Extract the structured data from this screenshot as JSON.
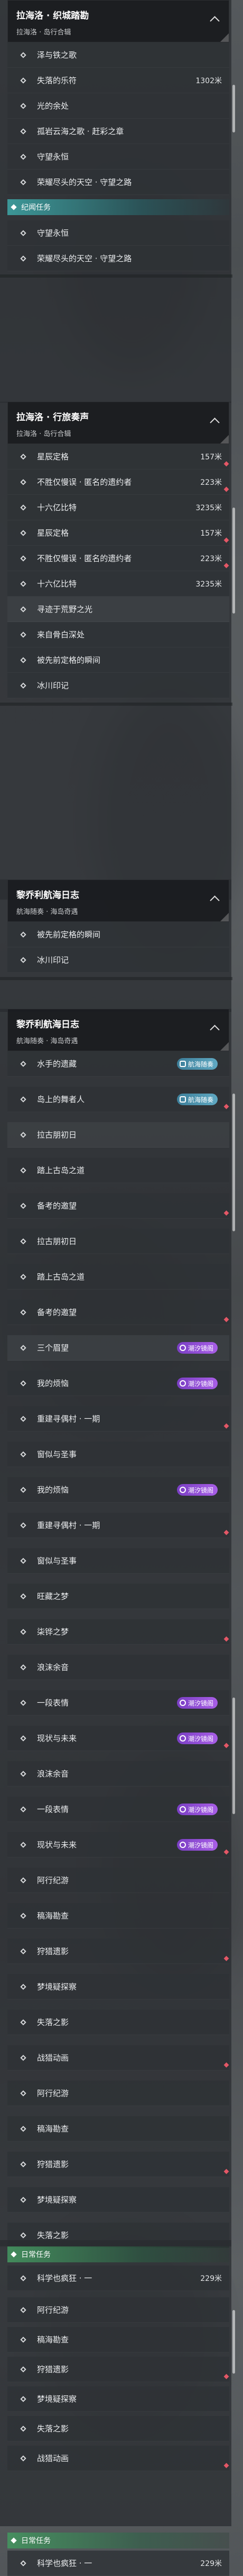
{
  "panel1": {
    "title": "拉海洛 · 织城踏勘",
    "subtitle": "拉海洛 · 岛行合辑",
    "items": [
      {
        "label": "泽与铁之歌",
        "dist": ""
      },
      {
        "label": "失落的乐符",
        "dist": "1302米"
      },
      {
        "label": "光的余处",
        "dist": ""
      },
      {
        "label": "孤岩云海之歌 · 赶彩之章",
        "dist": ""
      },
      {
        "label": "守望永恒",
        "dist": ""
      },
      {
        "label": "荣耀尽头的天空 · 守望之路",
        "dist": ""
      }
    ],
    "section": "纪闻任务",
    "items2": [
      {
        "label": "守望永恒",
        "dist": ""
      },
      {
        "label": "荣耀尽头的天空 · 守望之路",
        "dist": ""
      }
    ]
  },
  "panel2": {
    "title": "拉海洛 · 行旅奏声",
    "subtitle": "拉海洛 · 岛行合辑",
    "items": [
      {
        "label": "星辰定格",
        "dist": "157米"
      },
      {
        "label": "不胜仅慢误 · 匿名的遗约者",
        "dist": "223米"
      },
      {
        "label": "十六亿比特",
        "dist": "3235米"
      },
      {
        "label": "星辰定格",
        "dist": "157米"
      },
      {
        "label": "不胜仅慢误 · 匿名的遗约者",
        "dist": "223米"
      },
      {
        "label": "十六亿比特",
        "dist": "3235米"
      },
      {
        "label": "寻迹于荒野之光",
        "dist": ""
      },
      {
        "label": "来自骨白深处",
        "dist": ""
      },
      {
        "label": "被先前定格的瞬间",
        "dist": ""
      },
      {
        "label": "冰川印记",
        "dist": ""
      }
    ]
  },
  "panel3": {
    "title": "黎乔利航海日志",
    "subtitle": "航海随奏 · 海岛奇遇",
    "items": [
      {
        "label": "被先前定格的瞬间"
      },
      {
        "label": "冰川印记"
      }
    ]
  },
  "panel4": {
    "title": "黎乔利航海日志",
    "subtitle": "航海随奏 · 海岛奇遇",
    "badge_wave": "航海随奏",
    "badge_mist": "潮汐镜阁",
    "items": [
      {
        "label": "水手的遗藏",
        "badge": "wave"
      },
      {
        "label": "岛上的舞者人",
        "badge": "wave"
      },
      {
        "label": "拉古朋初日",
        "badge": ""
      },
      {
        "label": "踏上古岛之道",
        "badge": ""
      },
      {
        "label": "备考的邀望",
        "badge": ""
      },
      {
        "label": "拉古朋初日",
        "badge": ""
      },
      {
        "label": "踏上古岛之道",
        "badge": ""
      },
      {
        "label": "备考的邀望",
        "badge": ""
      },
      {
        "label": "三个眉望",
        "badge": "mist"
      },
      {
        "label": "我的烦恼",
        "badge": "mist"
      },
      {
        "label": "重建寻偶村 · 一期",
        "badge": ""
      },
      {
        "label": "窗似与圣事",
        "badge": ""
      },
      {
        "label": "我的烦恼",
        "badge": "mist"
      },
      {
        "label": "重建寻偶村 · 一期",
        "badge": ""
      },
      {
        "label": "窗似与圣事",
        "badge": ""
      },
      {
        "label": "旺藏之梦",
        "badge": ""
      },
      {
        "label": "柒铧之梦",
        "badge": ""
      },
      {
        "label": "浪沫余音",
        "badge": ""
      },
      {
        "label": "一段表情",
        "badge": "mist"
      },
      {
        "label": "现状与未来",
        "badge": "mist"
      },
      {
        "label": "浪沫余音",
        "badge": ""
      },
      {
        "label": "一段表情",
        "badge": "mist"
      },
      {
        "label": "现状与未来",
        "badge": "mist"
      },
      {
        "label": "阿行纪游",
        "badge": ""
      },
      {
        "label": "稿海勘查",
        "badge": ""
      },
      {
        "label": "狩猎遗影",
        "badge": ""
      },
      {
        "label": "梦境疑探察",
        "badge": ""
      },
      {
        "label": "失落之影",
        "badge": ""
      },
      {
        "label": "战猎动画",
        "badge": ""
      },
      {
        "label": "阿行纪游",
        "badge": ""
      },
      {
        "label": "稿海勘查",
        "badge": ""
      },
      {
        "label": "狩猎遗影",
        "badge": ""
      },
      {
        "label": "梦境疑探察",
        "badge": ""
      },
      {
        "label": "失落之影",
        "badge": ""
      }
    ]
  },
  "daily1": {
    "section": "日常任务",
    "label": "科学也疯狂 · 一",
    "dist": "229米",
    "items": [
      {
        "label": "阿行纪游"
      },
      {
        "label": "稿海勘查"
      },
      {
        "label": "狩猎遗影"
      },
      {
        "label": "梦境疑探察"
      },
      {
        "label": "失落之影"
      },
      {
        "label": "战猎动画"
      }
    ]
  },
  "daily2": {
    "section": "日常任务",
    "label": "科学也疯狂 · 一",
    "dist": "229米"
  }
}
